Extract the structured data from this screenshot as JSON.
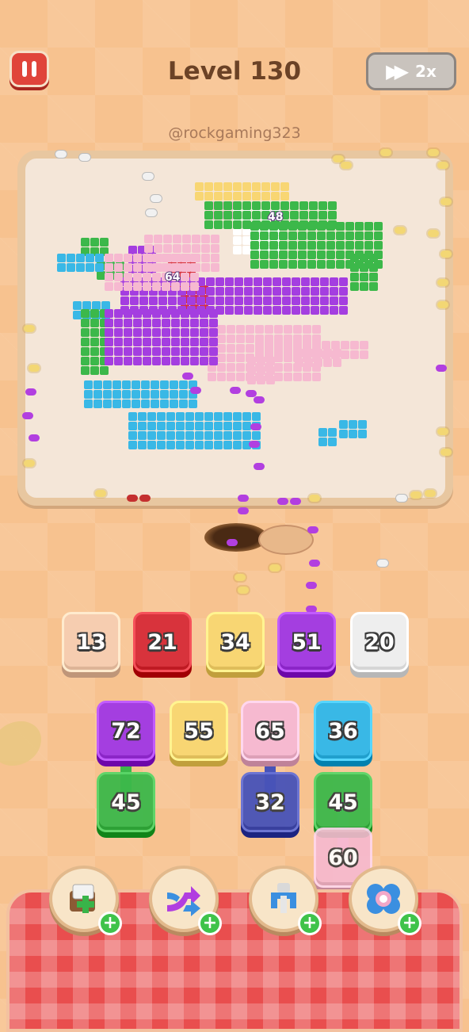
{
  "header": {
    "level_label": "Level 130",
    "speed_label": "2x",
    "watermark": "@rockgaming323"
  },
  "icons": {
    "pause": "pause-icon",
    "speed": "fast-forward-icon",
    "boosters": [
      "add-tray-icon",
      "shuffle-arrows-icon",
      "magnet-icon",
      "flower-icon"
    ]
  },
  "board": {
    "badges": [
      "48",
      "64"
    ]
  },
  "slots": [
    {
      "value": "13",
      "color": "#f6cdb0"
    },
    {
      "value": "21",
      "color": "#d8333c"
    },
    {
      "value": "34",
      "color": "#f8d673"
    },
    {
      "value": "51",
      "color": "#a43ee0"
    },
    {
      "value": "20",
      "color": "#eeeeee"
    }
  ],
  "queue_front": [
    {
      "value": "72",
      "color": "#a43ee0"
    },
    {
      "value": "55",
      "color": "#f8d673"
    },
    {
      "value": "65",
      "color": "#f6b9d0"
    },
    {
      "value": "36",
      "color": "#39b8e6"
    }
  ],
  "queue_back": [
    {
      "value": "45",
      "color": "#3cb84a"
    },
    {
      "value": "32",
      "color": "#4853b8"
    },
    {
      "value": "45",
      "color": "#3cb84a"
    },
    {
      "value": "60",
      "color": "#f6b9d0"
    }
  ],
  "colors": {
    "background": "#f7c28f",
    "pink": "#f6b9d0",
    "purple": "#a43ee0",
    "green": "#3cb84a",
    "cyan": "#39b8e6",
    "yellow": "#f8d673",
    "red": "#d8333c"
  }
}
